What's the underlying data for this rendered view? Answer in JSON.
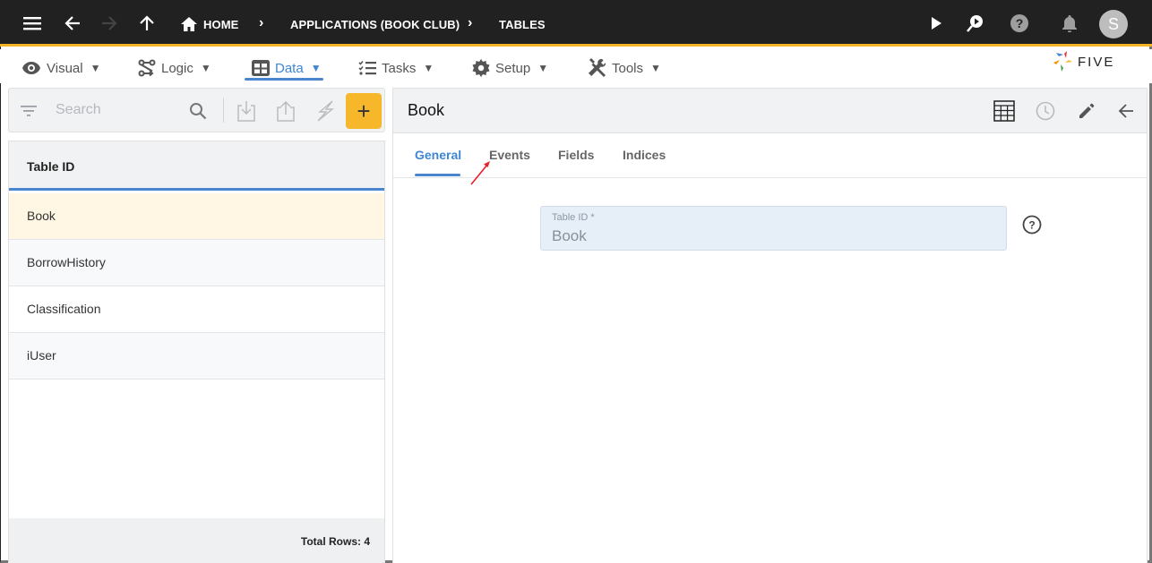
{
  "topbar": {
    "breadcrumbs": [
      "HOME",
      "APPLICATIONS (BOOK CLUB)",
      "TABLES"
    ],
    "avatar_initial": "S",
    "icons": [
      "menu-icon",
      "back-arrow-icon",
      "forward-arrow-icon",
      "up-arrow-icon",
      "home-icon",
      "run-icon",
      "debug-search-icon",
      "help-icon",
      "notifications-bell-icon"
    ]
  },
  "menubar": {
    "items": [
      {
        "label": "Visual",
        "icon": "eye-icon"
      },
      {
        "label": "Logic",
        "icon": "logic-flow-icon"
      },
      {
        "label": "Data",
        "icon": "table-grid-icon",
        "active": true
      },
      {
        "label": "Tasks",
        "icon": "checklist-icon"
      },
      {
        "label": "Setup",
        "icon": "gear-icon"
      },
      {
        "label": "Tools",
        "icon": "tools-icon"
      }
    ],
    "caret": "▼",
    "logo_text": "FIVE"
  },
  "left_panel": {
    "search_placeholder": "Search",
    "add_label": "+",
    "column_header": "Table ID",
    "rows": [
      "Book",
      "BorrowHistory",
      "Classification",
      "iUser"
    ],
    "selected_row": "Book",
    "footer": "Total Rows: 4"
  },
  "detail": {
    "title": "Book",
    "tabs": [
      "General",
      "Events",
      "Fields",
      "Indices"
    ],
    "active_tab": "General",
    "field": {
      "label": "Table ID *",
      "value": "Book"
    }
  },
  "colors": {
    "accent_blue": "#4a86d0",
    "accent_yellow": "#f6b72b",
    "topbar_bg": "#212121",
    "selected_row_bg": "#fff6e3"
  }
}
